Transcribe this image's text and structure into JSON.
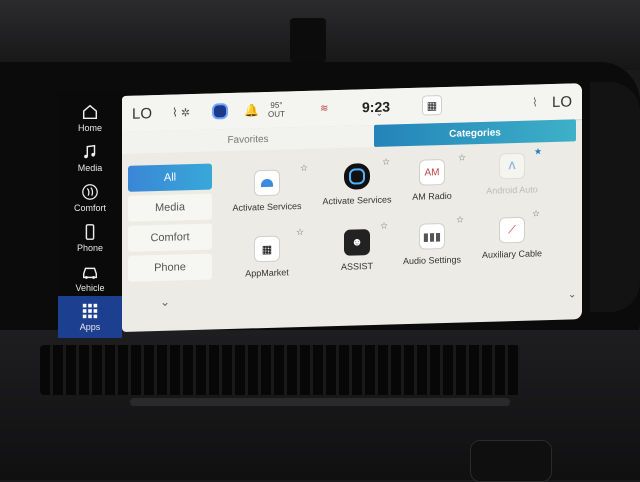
{
  "status_bar": {
    "left_temp": "LO",
    "outside_temp_value": "95°",
    "outside_temp_unit": "OUT",
    "time": "9:23",
    "right_temp": "LO"
  },
  "nav": {
    "items": [
      {
        "label": "Home",
        "icon": "home-icon"
      },
      {
        "label": "Media",
        "icon": "music-note-icon"
      },
      {
        "label": "Comfort",
        "icon": "seat-heat-icon"
      },
      {
        "label": "Phone",
        "icon": "phone-icon"
      },
      {
        "label": "Vehicle",
        "icon": "vehicle-icon"
      },
      {
        "label": "Apps",
        "icon": "apps-grid-icon",
        "active": true
      }
    ]
  },
  "tabs": {
    "favorites": "Favorites",
    "categories": "Categories"
  },
  "categories": [
    "All",
    "Media",
    "Comfort",
    "Phone"
  ],
  "apps": [
    {
      "name": "Activate Services",
      "icon": "alexa-icon"
    },
    {
      "name": "Activate Services",
      "icon": "alexa-ring-icon"
    },
    {
      "name": "AM Radio",
      "icon": "am-radio-icon",
      "badge": "AM"
    },
    {
      "name": "Android Auto",
      "icon": "android-auto-icon",
      "disabled": true
    },
    {
      "name": "AppMarket",
      "icon": "appmarket-icon"
    },
    {
      "name": "ASSIST",
      "icon": "assist-icon"
    },
    {
      "name": "Audio Settings",
      "icon": "audio-settings-icon"
    },
    {
      "name": "Auxiliary Cable",
      "icon": "aux-cable-icon"
    }
  ],
  "colors": {
    "accent": "#1d3f8f",
    "tab_active": "#2a92c0"
  }
}
